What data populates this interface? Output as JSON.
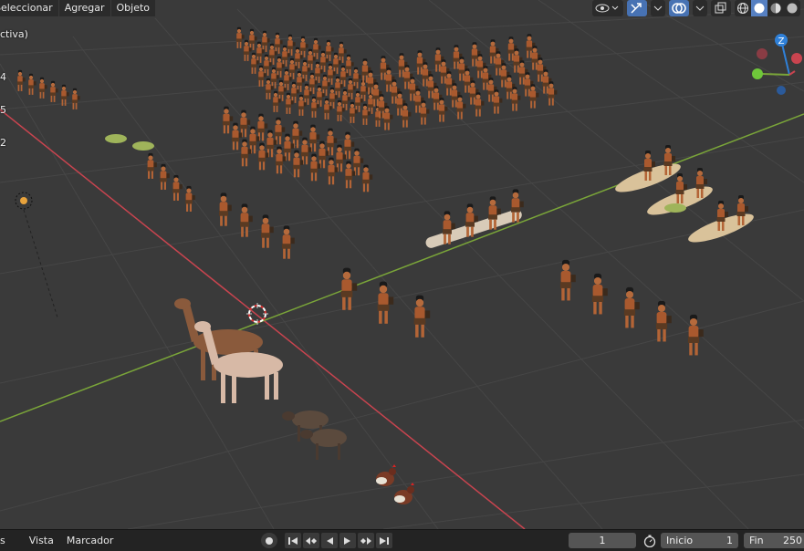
{
  "header": {
    "menu": [
      "Seleccionar",
      "Agregar",
      "Objeto"
    ]
  },
  "overlay": {
    "mode_text": "ctiva)",
    "side_numbers": [
      "4",
      "5",
      "2"
    ]
  },
  "gizmo": {
    "z_label": "Z"
  },
  "timeline": {
    "menu": [
      "s",
      "Vista",
      "Marcador"
    ],
    "current_frame": "1",
    "start_label": "Inicio",
    "start_value": "1",
    "end_label": "Fin",
    "end_value": "250"
  },
  "colors": {
    "x_axis": "#c9444f",
    "y_axis": "#7aa539",
    "z_axis": "#2f80d8",
    "accent": "#4772b3"
  }
}
